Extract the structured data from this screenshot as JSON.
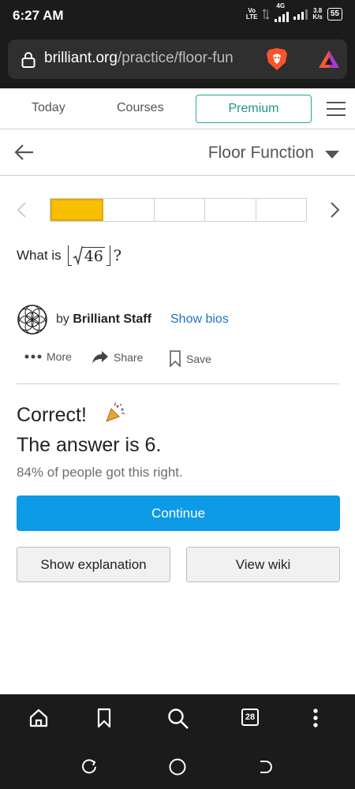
{
  "status": {
    "time": "6:27 AM",
    "volte_top": "Vo",
    "volte_bottom": "LTE",
    "net_type": "4G",
    "speed_value": "3.8",
    "speed_unit": "K/s",
    "battery": "55"
  },
  "browser": {
    "url_host": "brilliant.org",
    "url_path": "/practice/floor-fun"
  },
  "nav": {
    "today": "Today",
    "courses": "Courses",
    "premium": "Premium"
  },
  "topic": {
    "title": "Floor Function"
  },
  "progress": {
    "segments": 5,
    "current": 1
  },
  "question": {
    "prefix": "What is",
    "radicand": "46",
    "suffix": "?"
  },
  "author": {
    "by": "by",
    "name": "Brilliant Staff",
    "bios": "Show bios"
  },
  "actions": {
    "more": "More",
    "share": "Share",
    "save": "Save"
  },
  "result": {
    "correct": "Correct!",
    "answer": "The answer is 6.",
    "stat": "84% of people got this right."
  },
  "buttons": {
    "continue": "Continue",
    "explanation": "Show explanation",
    "wiki": "View wiki"
  },
  "toolbar": {
    "tab_count": "28"
  },
  "colors": {
    "accent_teal": "#2aa596",
    "progress_fill": "#f7bf00",
    "continue_blue": "#0d9ae6",
    "link_blue": "#1a73c8"
  }
}
